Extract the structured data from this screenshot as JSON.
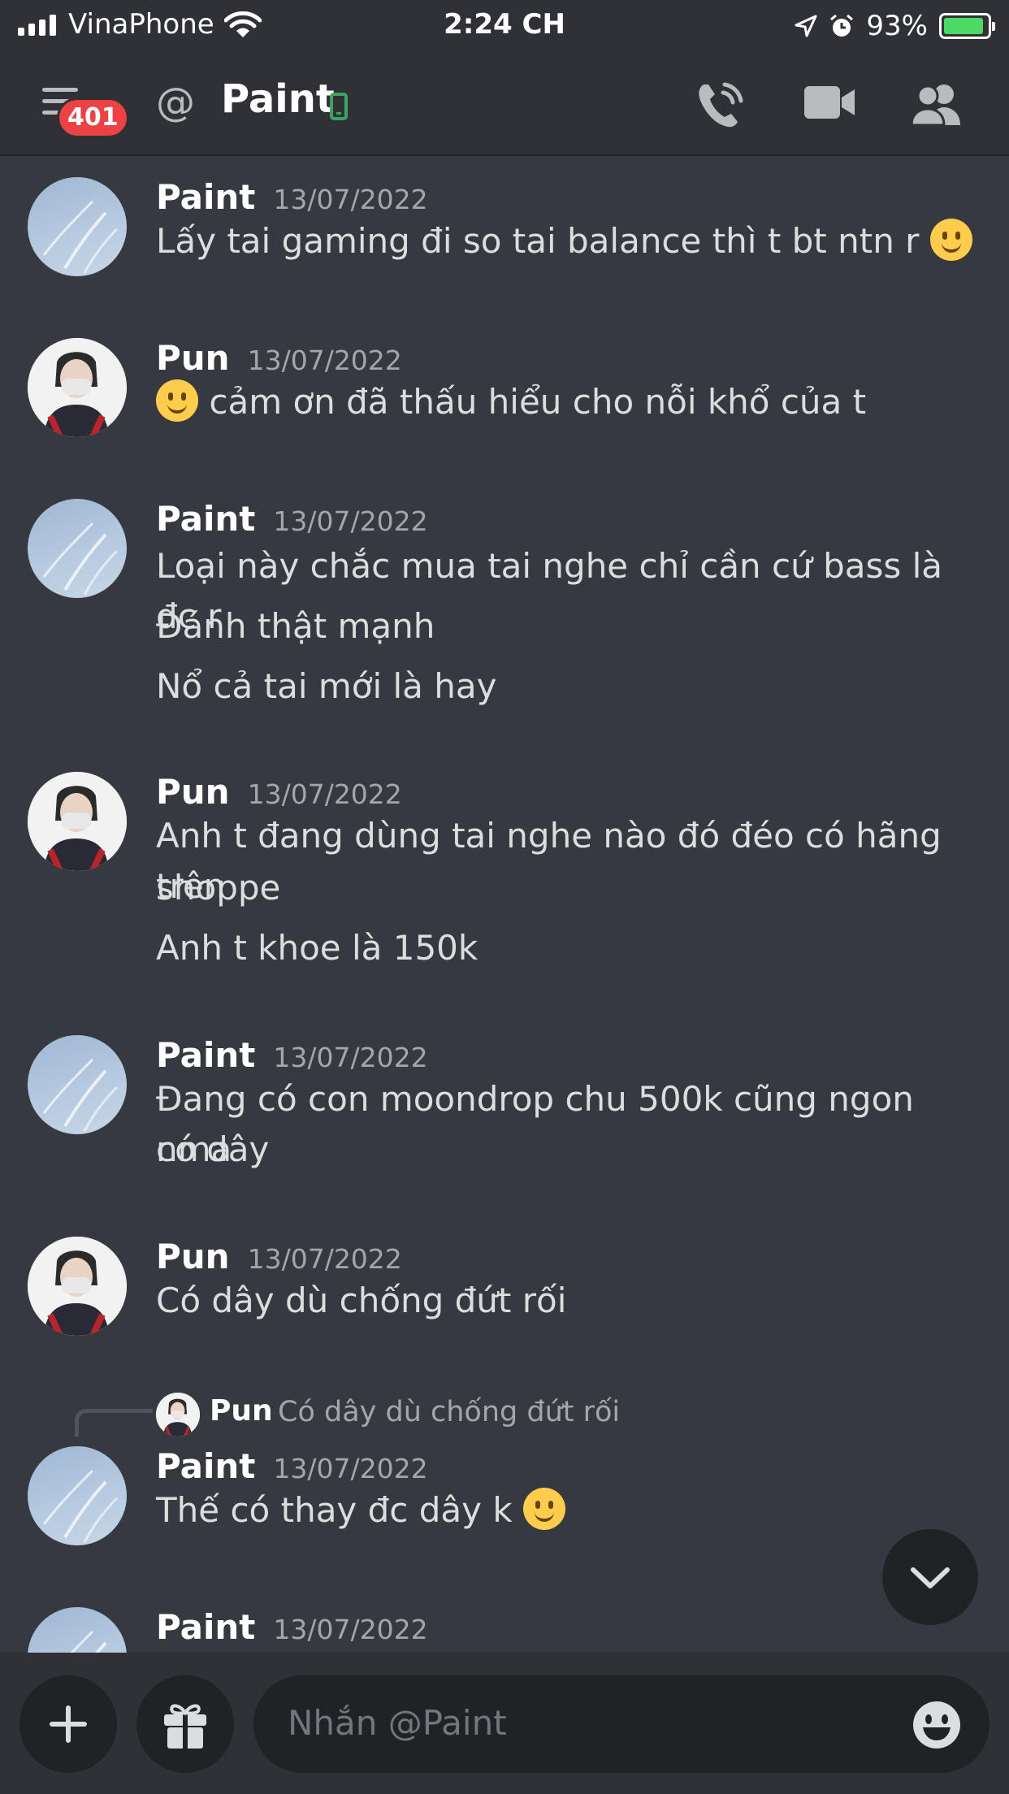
{
  "status_bar": {
    "carrier": "VinaPhone",
    "time": "2:24 CH",
    "battery": "93%",
    "battery_level": 0.93
  },
  "header": {
    "badge_count": "401",
    "at_symbol": "@",
    "title": "Paint",
    "icons": [
      "menu-icon",
      "mobile-online-icon",
      "voice-call-icon",
      "video-call-icon",
      "members-icon"
    ]
  },
  "messages": [
    {
      "author": "Paint",
      "timestamp": "13/07/2022",
      "lines": [
        "Lấy tai gaming đi so tai balance thì t bt ntn r"
      ],
      "trailing_emoji": "slightly-smiling-face"
    },
    {
      "author": "Pun",
      "timestamp": "13/07/2022",
      "lines": [
        "cảm ơn đã thấu hiểu cho nỗi khổ của t"
      ],
      "leading_emoji": "slightly-smiling-face"
    },
    {
      "author": "Paint",
      "timestamp": "13/07/2022",
      "lines": [
        "Loại này chắc mua tai nghe chỉ cần cứ bass là đc r",
        "Đánh thật mạnh",
        "Nổ cả tai mới là hay"
      ]
    },
    {
      "author": "Pun",
      "timestamp": "13/07/2022",
      "lines": [
        "Anh t đang dùng tai nghe nào đó đéo có hãng trên",
        "shoppe",
        "Anh t khoe là 150k"
      ]
    },
    {
      "author": "Paint",
      "timestamp": "13/07/2022",
      "lines": [
        "Đang có con moondrop chu 500k cũng ngon nma",
        "có dây"
      ]
    },
    {
      "author": "Pun",
      "timestamp": "13/07/2022",
      "lines": [
        "Có dây dù chống đứt rối"
      ]
    },
    {
      "author": "Paint",
      "timestamp": "13/07/2022",
      "lines": [
        "Thế có thay đc dây k"
      ],
      "trailing_emoji": "slightly-smiling-face",
      "reply_to": {
        "author": "Pun",
        "text": "Có dây dù chống đứt rối"
      }
    },
    {
      "author": "Paint",
      "timestamp": "13/07/2022",
      "lines": []
    }
  ],
  "jump_button": {
    "icon": "chevron-down-icon"
  },
  "composer": {
    "placeholder": "Nhắn @Paint",
    "icons": [
      "plus-icon",
      "gift-icon",
      "emoji-icon"
    ]
  }
}
